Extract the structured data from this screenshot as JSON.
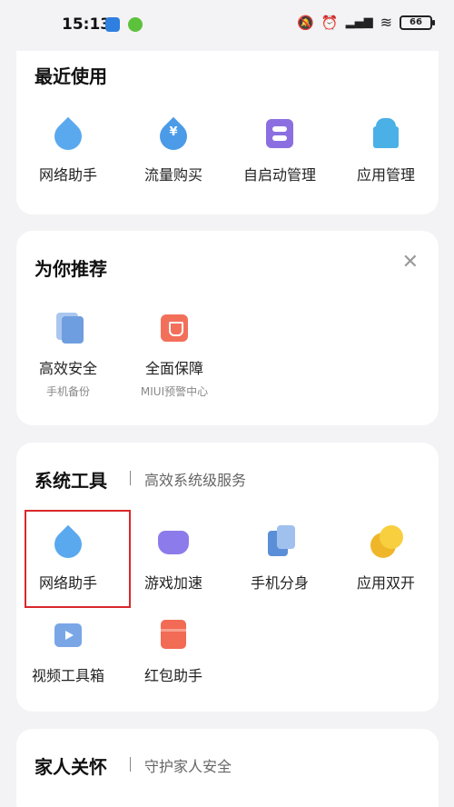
{
  "status_bar": {
    "time": "15:13",
    "battery": "66"
  },
  "recent": {
    "title": "最近使用",
    "items": [
      {
        "label": "网络助手",
        "icon": "drop-icon"
      },
      {
        "label": "流量购买",
        "icon": "yen-drop-icon"
      },
      {
        "label": "自启动管理",
        "icon": "toggle-icon"
      },
      {
        "label": "应用管理",
        "icon": "android-icon"
      }
    ]
  },
  "recommend": {
    "title": "为你推荐",
    "items": [
      {
        "label": "高效安全",
        "sub": "手机备份",
        "icon": "backup-icon"
      },
      {
        "label": "全面保障",
        "sub": "MIUI预警中心",
        "icon": "shield-bag-icon"
      }
    ]
  },
  "tools": {
    "title": "系统工具",
    "subtitle": "高效系统级服务",
    "items": [
      {
        "label": "网络助手",
        "icon": "drop-icon"
      },
      {
        "label": "游戏加速",
        "icon": "game-icon"
      },
      {
        "label": "手机分身",
        "icon": "clone-icon"
      },
      {
        "label": "应用双开",
        "icon": "dual-app-icon"
      },
      {
        "label": "视频工具箱",
        "icon": "video-toolbox-icon"
      },
      {
        "label": "红包助手",
        "icon": "red-packet-icon"
      }
    ]
  },
  "family": {
    "title": "家人关怀",
    "subtitle": "守护家人安全"
  },
  "colors": {
    "highlight": "#d9282c",
    "accent": "#5aa9ef"
  }
}
